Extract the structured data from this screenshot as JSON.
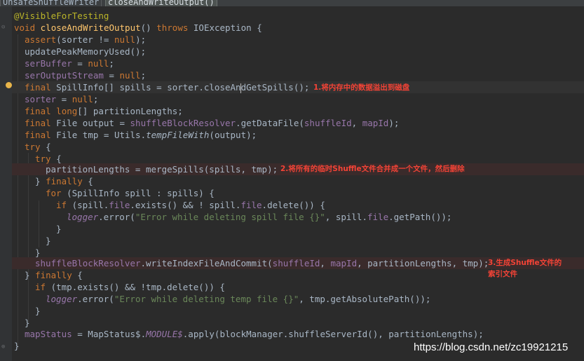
{
  "breadcrumb": [
    "UnsafeShuffleWriter",
    "closeAndWriteOutput()"
  ],
  "code": {
    "l1": [
      "@VisibleForTesting"
    ],
    "l2": [
      "void",
      " ",
      "closeAndWriteOutput",
      "() ",
      "throws",
      " IOException {"
    ],
    "l3": [
      "assert",
      "(sorter != ",
      "null",
      ");"
    ],
    "l4": [
      "updatePeakMemoryUsed();"
    ],
    "l5": [
      "serBuffer",
      " = ",
      "null",
      ";"
    ],
    "l6": [
      "serOutputStream",
      " = ",
      "null",
      ";"
    ],
    "l7": [
      "final",
      " SpillInfo[] spills = sorter.closeAn",
      "dGetSpills();"
    ],
    "l8": [
      "sorter",
      " = ",
      "null",
      ";"
    ],
    "l9": [
      "final",
      " ",
      "long",
      "[] partitionLengths;"
    ],
    "l10": [
      "final",
      " File output = ",
      "shuffleBlockResolver",
      ".getDataFile(",
      "shuffleId",
      ", ",
      "mapId",
      ");"
    ],
    "l11": [
      "final",
      " File tmp = Utils.",
      "tempFileWith",
      "(output);"
    ],
    "l12": [
      "try",
      " {"
    ],
    "l13": [
      "try",
      " {"
    ],
    "l14": [
      "partitionLengths = mergeSpills(spills, tmp);"
    ],
    "l15": [
      "} ",
      "finally",
      " {"
    ],
    "l16": [
      "for",
      " (SpillInfo spill : spills) {"
    ],
    "l17": [
      "if",
      " (spill.",
      "file",
      ".exists() && ! spill.",
      "file",
      ".delete()) {"
    ],
    "l18": [
      "logger",
      ".error(",
      "\"Error while deleting spill file {}\"",
      ", spill.",
      "file",
      ".getPath());"
    ],
    "l19": [
      "}"
    ],
    "l20": [
      "}"
    ],
    "l21": [
      "}"
    ],
    "l22": [
      "shuffleBlockResolver",
      ".writeIndexFileAndCommit(",
      "shuffleId",
      ", ",
      "mapId",
      ", partitionLengths, tmp);"
    ],
    "l23": [
      "} ",
      "finally",
      " {"
    ],
    "l24": [
      "if",
      " (tmp.exists() && !tmp.delete()) {"
    ],
    "l25": [
      "logger",
      ".error(",
      "\"Error while deleting temp file {}\"",
      ", tmp.getAbsolutePath());"
    ],
    "l26": [
      "}"
    ],
    "l27": [
      "}"
    ],
    "l28": [
      "mapStatus",
      " = MapStatus$.",
      "MODULE$",
      ".apply(blockManager.shuffleServerId(), partitionLengths);"
    ],
    "l29": [
      "}"
    ]
  },
  "notes": {
    "n1": "1.将内存中的数据溢出到磁盘",
    "n2": "2.将所有的临时Shuffle文件合并成一个文件，然后删除",
    "n3a": "3.生成Shuffle文件的",
    "n3b": "索引文件"
  },
  "watermark": "https://blog.csdn.net/zc19921215",
  "colors": {
    "background": "#2b2b2b",
    "keyword": "#cc7832",
    "annotation": "#bbb529",
    "method_decl": "#ffc66d",
    "field": "#9876aa",
    "string": "#6a8759",
    "plain": "#a9b7c6",
    "note_red": "#f44336"
  },
  "icons": [
    "lightbulb-icon",
    "fold-marker-icon"
  ]
}
